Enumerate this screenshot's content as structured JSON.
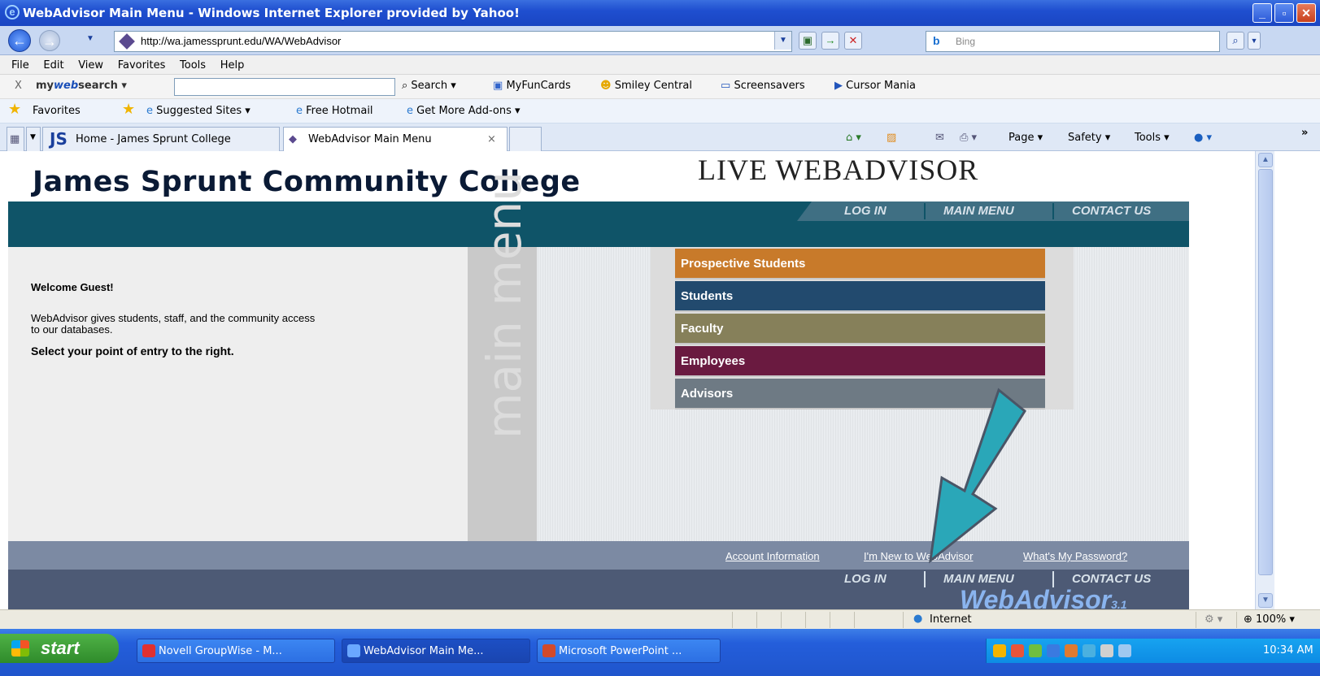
{
  "window": {
    "title": "WebAdvisor Main Menu - Windows Internet Explorer provided by Yahoo!",
    "buttons": {
      "minimize": "_",
      "maximize": "▫",
      "close": "✕"
    }
  },
  "address": {
    "url": "http://wa.jamessprunt.edu/WA/WebAdvisor",
    "search_placeholder": "Bing",
    "search_brand": "b"
  },
  "menubar": [
    "File",
    "Edit",
    "View",
    "Favorites",
    "Tools",
    "Help"
  ],
  "mywebsearch": {
    "close": "X",
    "brand_prefix": "my",
    "brand_bold": "web",
    "brand_suffix": "search",
    "search_button": "Search",
    "items": [
      "MyFunCards",
      "Smiley Central",
      "Screensavers",
      "Cursor Mania"
    ]
  },
  "favorites": {
    "label": "Favorites",
    "items": [
      "Suggested Sites",
      "Free Hotmail",
      "Get More Add-ons"
    ]
  },
  "tabs": [
    {
      "label": "Home - James Sprunt College",
      "prefix": "JS"
    },
    {
      "label": "WebAdvisor Main Menu",
      "close": "×"
    }
  ],
  "commandbar": [
    "Page",
    "Safety",
    "Tools"
  ],
  "site": {
    "college_name": "James Sprunt Community College",
    "live_title": "LIVE WEBADVISOR",
    "nav": [
      "LOG IN",
      "MAIN MENU",
      "CONTACT US"
    ],
    "watermark": "main menu",
    "welcome_heading": "Welcome Guest!",
    "intro_line1": "WebAdvisor gives students, staff, and the community access",
    "intro_line2": "to our databases.",
    "select_prompt": "Select your point of entry to the right.",
    "menu": [
      {
        "label": "Prospective Students",
        "color": "#c87a2a"
      },
      {
        "label": "Students",
        "color": "#224a6e"
      },
      {
        "label": "Faculty",
        "color": "#86805a"
      },
      {
        "label": "Employees",
        "color": "#6a1a40"
      },
      {
        "label": "Advisors",
        "color": "#6e7a84"
      }
    ],
    "footer_links": [
      "Account Information",
      "I'm New to WebAdvisor",
      "What's My Password?"
    ],
    "footer_nav": [
      "LOG IN",
      "MAIN MENU",
      "CONTACT US"
    ],
    "logo_text": "WebAdvisor",
    "logo_version": "3.1",
    "arrow_color": "#2aa7b8"
  },
  "status": {
    "zone": "Internet",
    "zoom": "100%"
  },
  "taskbar": {
    "start": "start",
    "tasks": [
      "Novell GroupWise - M...",
      "WebAdvisor Main Me...",
      "Microsoft PowerPoint ..."
    ],
    "time": "10:34 AM"
  }
}
